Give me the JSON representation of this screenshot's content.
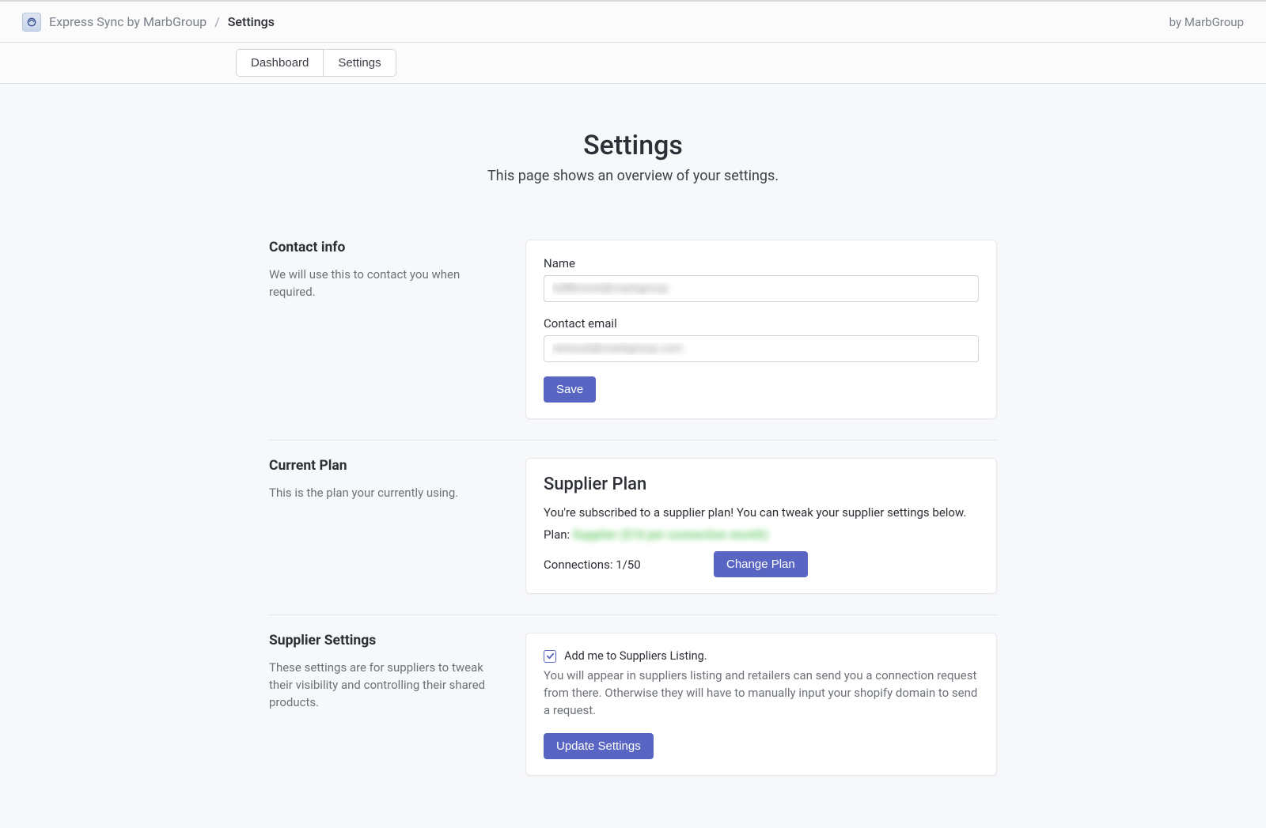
{
  "header": {
    "breadcrumb_main": "Express Sync by MarbGroup",
    "breadcrumb_sep": "/",
    "breadcrumb_current": "Settings",
    "byline": "by MarbGroup"
  },
  "nav": {
    "dashboard": "Dashboard",
    "settings": "Settings"
  },
  "page": {
    "title": "Settings",
    "subtitle": "This page shows an overview of your settings."
  },
  "contact": {
    "heading": "Contact info",
    "desc": "We will use this to contact you when required.",
    "name_label": "Name",
    "name_value": "fulfillment@marbgroup",
    "email_label": "Contact email",
    "email_value": "reinoud@marbgroup.com",
    "save_label": "Save"
  },
  "plan": {
    "heading": "Current Plan",
    "desc": "This is the plan your currently using.",
    "card_title": "Supplier Plan",
    "subscribed_line": "You're subscribed to a supplier plan! You can tweak your supplier settings below.",
    "plan_label": "Plan:",
    "plan_value": "Supplier ($10 per connection month)",
    "connections_label": "Connections: 1/50",
    "change_label": "Change Plan"
  },
  "supplier": {
    "heading": "Supplier Settings",
    "desc": "These settings are for suppliers to tweak their visibility and controlling their shared products.",
    "checkbox_label": "Add me to Suppliers Listing.",
    "note": "You will appear in suppliers listing and retailers can send you a connection request from there. Otherwise they will have to manually input your shopify domain to send a request.",
    "update_label": "Update Settings"
  }
}
